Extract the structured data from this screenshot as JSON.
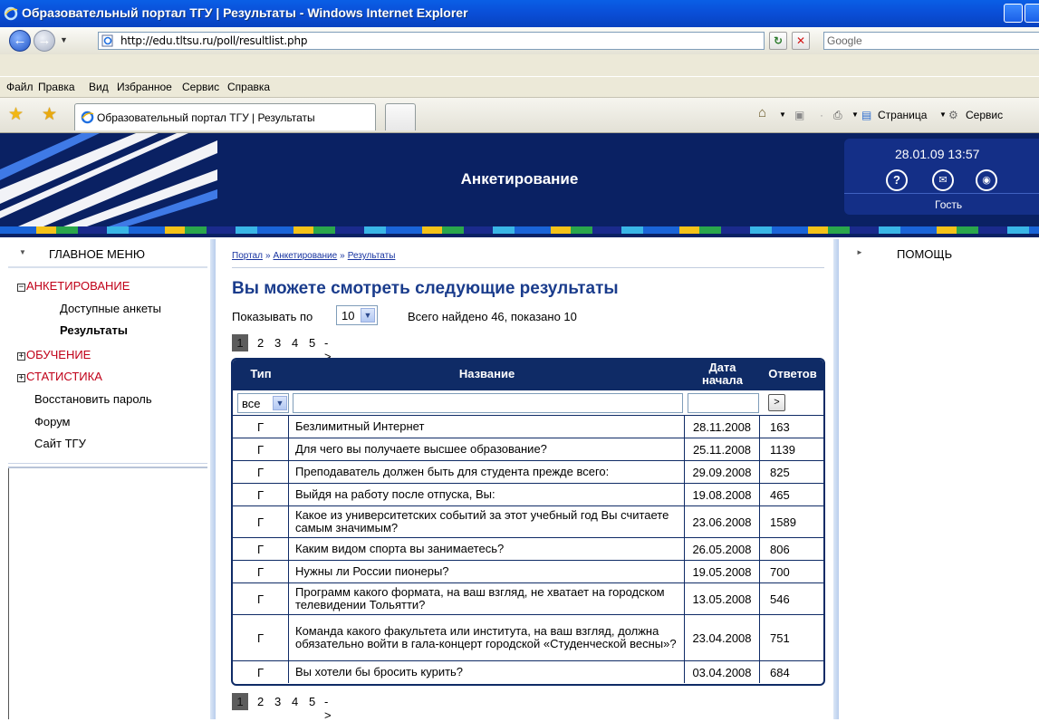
{
  "window": {
    "title": "Образовательный портал ТГУ | Результаты - Windows Internet Explorer"
  },
  "address_bar": {
    "url": "http://edu.tltsu.ru/poll/resultlist.php",
    "search_placeholder": "Google"
  },
  "menu_bar": {
    "items": [
      "Файл",
      "Правка",
      "Вид",
      "Избранное",
      "Сервис",
      "Справка"
    ]
  },
  "tabs": {
    "active_title": "Образовательный портал ТГУ | Результаты"
  },
  "command_bar": {
    "page_label": "Страница",
    "tools_label": "Сервис"
  },
  "header": {
    "title": "Анкетирование",
    "datetime": "28.01.09 13:57",
    "user": "Гость",
    "icons": [
      "help-icon",
      "mail-icon",
      "lock-icon"
    ]
  },
  "left_menu": {
    "heading": "ГЛАВНОЕ МЕНЮ",
    "sections": [
      {
        "label": "АНКЕТИРОВАНИЕ",
        "expanded": true,
        "children": [
          "Доступные анкеты",
          "Результаты"
        ]
      },
      {
        "label": "ОБУЧЕНИЕ",
        "expanded": false
      },
      {
        "label": "СТАТИСТИКА",
        "expanded": false
      }
    ],
    "links": [
      "Восстановить пароль",
      "Форум",
      "Сайт ТГУ"
    ]
  },
  "breadcrumb": [
    "Портал",
    "Анкетирование",
    "Результаты"
  ],
  "breadcrumb_sep": "»",
  "main": {
    "title": "Вы можете смотреть следующие результаты",
    "per_page_label": "Показывать по",
    "per_page_value": "10",
    "found_text": "Всего найдено 46, показано 10"
  },
  "pager": {
    "current": "1",
    "pages": [
      "2",
      "3",
      "4",
      "5"
    ],
    "next": "->"
  },
  "table": {
    "headers": {
      "type": "Тип",
      "name": "Название",
      "date_line1": "Дата",
      "date_line2": "начала",
      "answers": "Ответов"
    },
    "filter": {
      "type_value": "все",
      "go_label": ">"
    },
    "rows": [
      {
        "type": "Г",
        "name": "Безлимитный Интернет",
        "date": "28.11.2008",
        "answers": "163"
      },
      {
        "type": "Г",
        "name": "Для чего вы получаете высшее образование?",
        "date": "25.11.2008",
        "answers": "1139"
      },
      {
        "type": "Г",
        "name": "Преподаватель должен быть для студента прежде всего:",
        "date": "29.09.2008",
        "answers": "825"
      },
      {
        "type": "Г",
        "name": "Выйдя на работу после отпуска, Вы:",
        "date": "19.08.2008",
        "answers": "465"
      },
      {
        "type": "Г",
        "name": "Какое из университетских событий за этот учебный год Вы считаете самым значимым?",
        "date": "23.06.2008",
        "answers": "1589"
      },
      {
        "type": "Г",
        "name": "Каким видом спорта вы занимаетесь?",
        "date": "26.05.2008",
        "answers": "806"
      },
      {
        "type": "Г",
        "name": "Нужны ли России пионеры?",
        "date": "19.05.2008",
        "answers": "700"
      },
      {
        "type": "Г",
        "name": "Программ какого формата, на ваш взгляд, не хватает на городском телевидении Тольятти?",
        "date": "13.05.2008",
        "answers": "546"
      },
      {
        "type": "Г",
        "name": "Команда какого факультета или института, на ваш взгляд, должна обязательно войти в гала-концерт городской «Студенческой весны»?",
        "date": "23.04.2008",
        "answers": "751"
      },
      {
        "type": "Г",
        "name": "Вы хотели бы бросить курить?",
        "date": "03.04.2008",
        "answers": "684"
      }
    ]
  },
  "right_panel": {
    "heading": "ПОМОЩЬ"
  }
}
